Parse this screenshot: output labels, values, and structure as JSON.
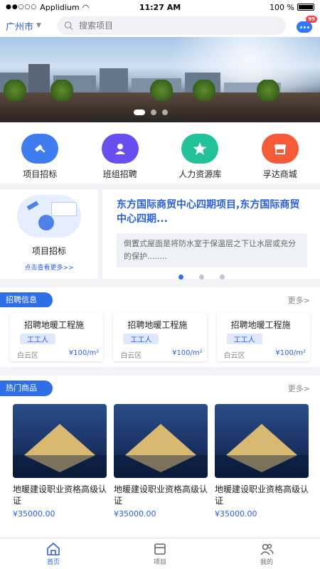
{
  "status_bar": {
    "carrier": "Applidium",
    "time": "11:27 AM",
    "battery": "100 %"
  },
  "header": {
    "city": "广州市",
    "search_placeholder": "搜索项目",
    "message_badge": "99"
  },
  "quick_nav": [
    {
      "label": "项目招标",
      "color": "#3f7cf0",
      "icon": "hammer-icon"
    },
    {
      "label": "班组招聘",
      "color": "#6b4ef0",
      "icon": "person-icon"
    },
    {
      "label": "人力资源库",
      "color": "#21c29a",
      "icon": "star-icon"
    },
    {
      "label": "孚达商城",
      "color": "#f55a39",
      "icon": "store-icon"
    }
  ],
  "feature": {
    "left_title": "项目招标",
    "left_more": "点击查看更多>>",
    "title": "东方国际商贸中心四期项目,东方国际商贸中心四期...",
    "desc": "倒置式屋面是将防水室于保温层之下让水层或充分的保护........"
  },
  "recruit_section": {
    "title": "招聘信息",
    "more": "更多>"
  },
  "jobs": [
    {
      "title": "招聘地暖工程施",
      "tag": "工工人",
      "location": "白云区",
      "price": "¥100/m²"
    },
    {
      "title": "招聘地暖工程施",
      "tag": "工工人",
      "location": "白云区",
      "price": "¥100/m²"
    },
    {
      "title": "招聘地暖工程施",
      "tag": "工工人",
      "location": "白云区",
      "price": "¥100/m²"
    }
  ],
  "hot_section": {
    "title": "热门商品",
    "more": "更多>"
  },
  "products": [
    {
      "name": "地暖建设职业资格高级认证",
      "price": "¥35000.00"
    },
    {
      "name": "地暖建设职业资格高级认证",
      "price": "¥35000.00"
    },
    {
      "name": "地暖建设职业资格高级认证",
      "price": "¥35000.00"
    }
  ],
  "tabs": [
    {
      "label": "首页",
      "active": true
    },
    {
      "label": "项目",
      "active": false
    },
    {
      "label": "我的",
      "active": false
    }
  ]
}
